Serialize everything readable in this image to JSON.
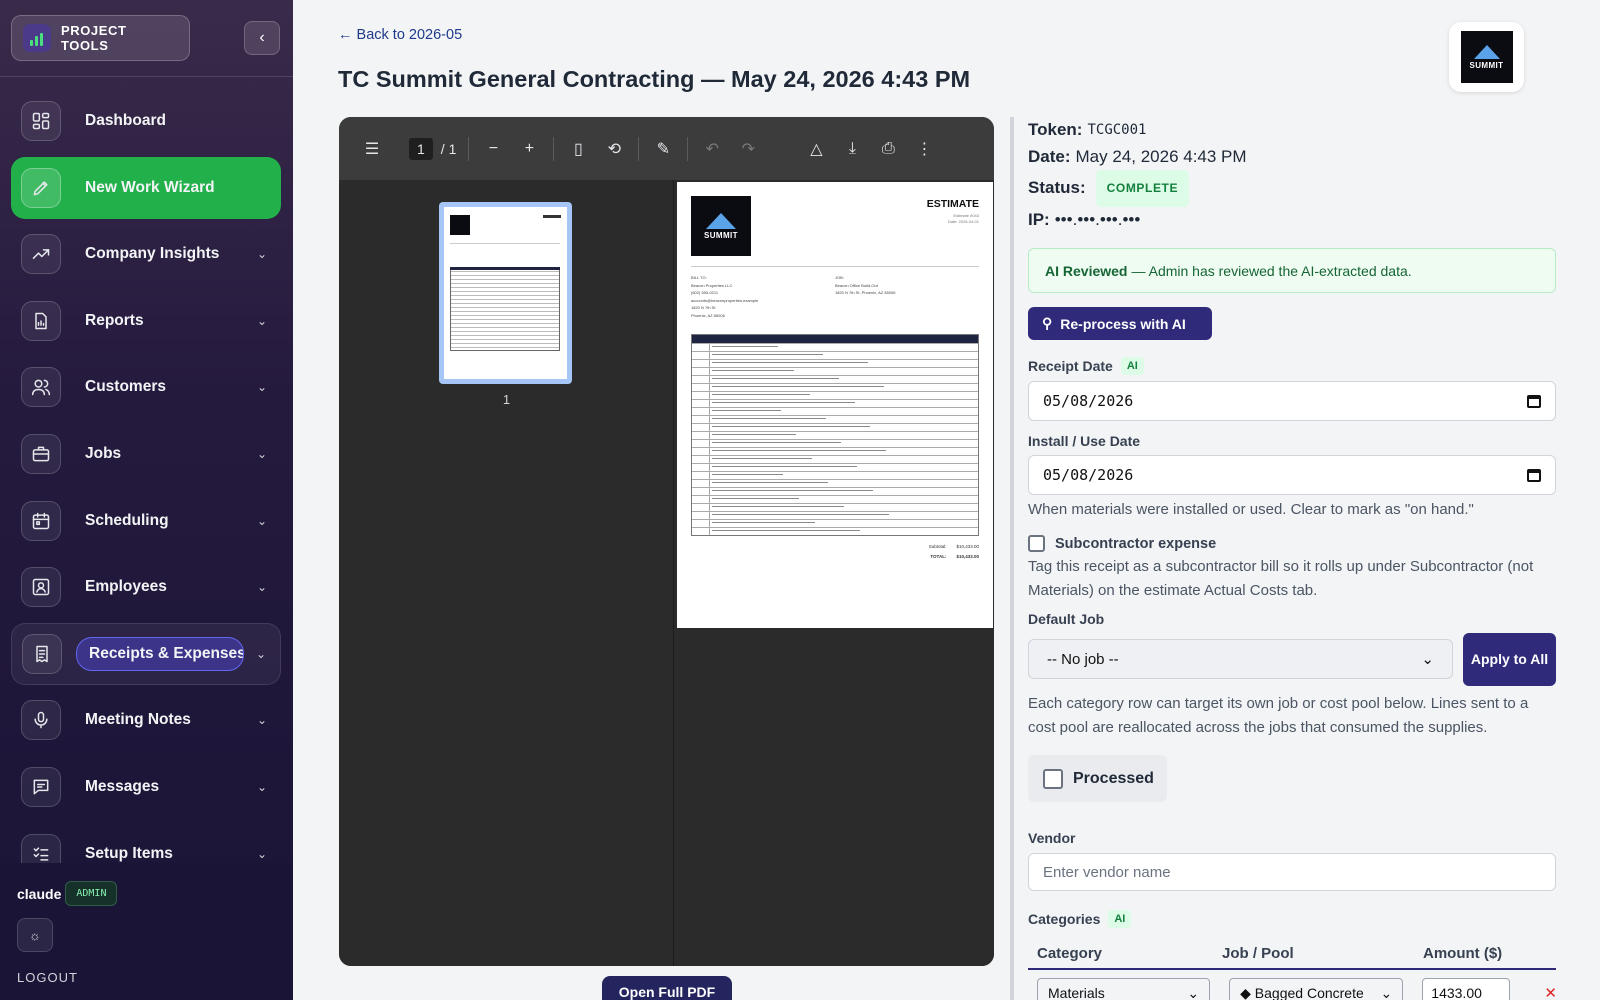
{
  "sidebar": {
    "brand": "PROJECT TOOLS",
    "collapse_icon": "chevron-left-icon",
    "items": [
      {
        "label": "Dashboard",
        "icon": "dashboard-icon",
        "chevron": false
      },
      {
        "label": "New Work Wizard",
        "icon": "pencil-icon",
        "chevron": false
      },
      {
        "label": "Company Insights",
        "icon": "trending-up-icon",
        "chevron": true
      },
      {
        "label": "Reports",
        "icon": "report-icon",
        "chevron": true
      },
      {
        "label": "Customers",
        "icon": "users-icon",
        "chevron": true
      },
      {
        "label": "Jobs",
        "icon": "briefcase-icon",
        "chevron": true
      },
      {
        "label": "Scheduling",
        "icon": "calendar-icon",
        "chevron": true
      },
      {
        "label": "Employees",
        "icon": "id-card-icon",
        "chevron": true
      },
      {
        "label": "Receipts & Expenses",
        "icon": "receipt-icon",
        "chevron": true
      },
      {
        "label": "Meeting Notes",
        "icon": "microphone-icon",
        "chevron": true
      },
      {
        "label": "Messages",
        "icon": "message-icon",
        "chevron": true
      },
      {
        "label": "Setup Items",
        "icon": "checklist-icon",
        "chevron": true
      }
    ],
    "user": {
      "name": "claude",
      "role": "ADMIN"
    },
    "logout": "LOGOUT",
    "accent_active": "#22b04b"
  },
  "header": {
    "back_link": "← Back to 2026-05",
    "title": "TC Summit General Contracting — May 24, 2026 4:43 PM"
  },
  "pdf_viewer": {
    "current_page": "1",
    "total_pages": "/ 1",
    "thumb_label": "1",
    "document": {
      "logo_text": "SUMMIT",
      "title": "ESTIMATE",
      "meta": [
        "Estimate #043",
        "Date: 2026-04-01"
      ],
      "bill_to": [
        "BILL TO:",
        "Beacon Properties LLC",
        "(602) 555-0211",
        "accounts@beaconproperties.example",
        "1820 N 7th St",
        "Phoenix, AZ 85006"
      ],
      "job": [
        "JOB:",
        "Beacon Office Build-Out",
        "1820 N 7th St, Phoenix, AZ 85006"
      ],
      "subtotal_label": "Subtotal:",
      "subtotal": "$10,433.00",
      "total_label": "TOTAL:",
      "total": "$10,433.00"
    },
    "open_button": "Open Full PDF"
  },
  "receipt": {
    "token_label": "Token:",
    "token": "TCGC001",
    "date_label": "Date:",
    "date": "May 24, 2026 4:43 PM",
    "status_label": "Status:",
    "status": "COMPLETE",
    "ip_label": "IP:",
    "ip": "•••.•••.•••.•••",
    "ai_reviewed_title": "AI Reviewed",
    "ai_reviewed_text": "— Admin has reviewed the AI-extracted data.",
    "reprocess_label": "Re-process with AI",
    "receipt_date_label": "Receipt Date",
    "ai_tag": "AI",
    "receipt_date": "05/08/2026",
    "install_date_label": "Install / Use Date",
    "install_date": "05/08/2026",
    "install_hint": "When materials were installed or used. Clear to mark as \"on hand.\"",
    "subcontractor_label": "Subcontractor expense",
    "subcontractor_hint": "Tag this receipt as a subcontractor bill so it rolls up under Subcontractor (not Materials) on the estimate Actual Costs tab.",
    "default_job_label": "Default Job",
    "default_job_value": "-- No job --",
    "apply_label": "Apply to All",
    "job_hint": "Each category row can target its own job or cost pool below. Lines sent to a cost pool are reallocated across the jobs that consumed the supplies.",
    "processed_label": "Processed",
    "vendor_label": "Vendor",
    "vendor_placeholder": "Enter vendor name",
    "categories_label": "Categories",
    "table_headers": {
      "category": "Category",
      "job_pool": "Job / Pool",
      "amount": "Amount ($)"
    },
    "rows": [
      {
        "category": "Materials",
        "job_pool": "◆ Bagged Concrete",
        "amount": "1433.00"
      }
    ],
    "accent": "#2f2a7a"
  }
}
